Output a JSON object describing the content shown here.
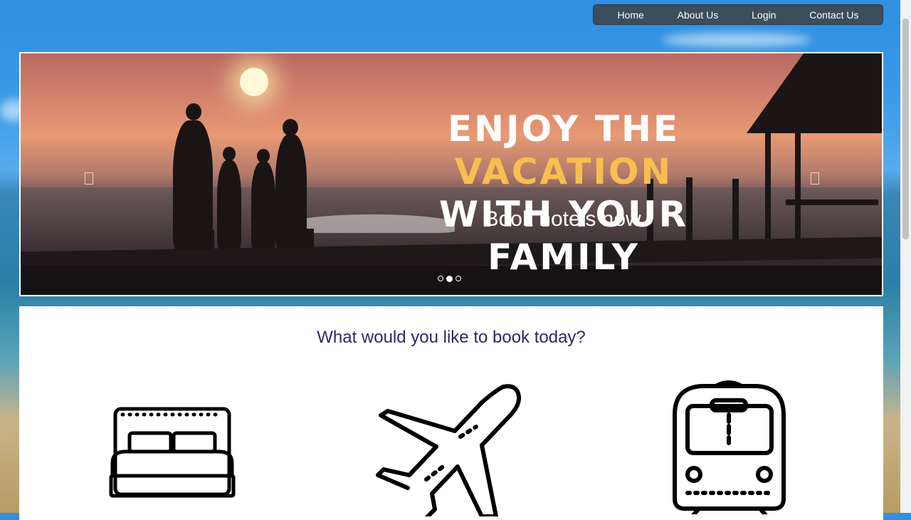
{
  "nav": {
    "items": [
      {
        "label": "Home"
      },
      {
        "label": "About Us"
      },
      {
        "label": "Login"
      },
      {
        "label": "Contact Us"
      }
    ]
  },
  "hero": {
    "headline_line1_prefix": "ENJOY THE",
    "headline_line1_accent": "VACATION",
    "headline_line2": "WITH YOUR FAMILY",
    "subtitle": "Book hotels now.",
    "slide_count": 3,
    "active_slide": 2,
    "accent_color": "#f6bf4f"
  },
  "booking": {
    "title": "What would you like to book today?",
    "options": [
      {
        "icon": "bed-icon"
      },
      {
        "icon": "airplane-icon"
      },
      {
        "icon": "train-icon"
      }
    ],
    "title_color": "#2b2966"
  }
}
